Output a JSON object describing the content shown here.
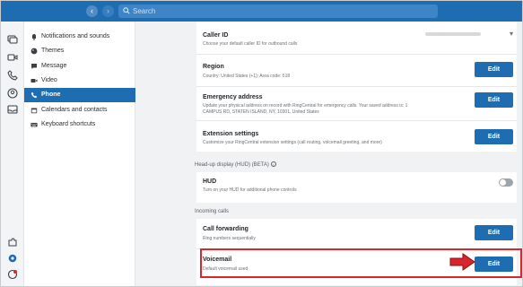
{
  "topbar": {
    "search_placeholder": "Search",
    "back_icon": "chevron-left-icon",
    "forward_icon": "chevron-right-icon",
    "color": "#1e6db3"
  },
  "settings_nav": {
    "items": [
      {
        "label": "Notifications and sounds",
        "icon": "bell-icon"
      },
      {
        "label": "Themes",
        "icon": "palette-icon"
      },
      {
        "label": "Message",
        "icon": "message-icon"
      },
      {
        "label": "Video",
        "icon": "video-icon"
      },
      {
        "label": "Phone",
        "icon": "phone-icon",
        "active": true
      },
      {
        "label": "Calendars and contacts",
        "icon": "calendar-icon"
      },
      {
        "label": "Keyboard shortcuts",
        "icon": "keyboard-icon"
      }
    ]
  },
  "phone_settings": {
    "caller_id": {
      "title": "Caller ID",
      "desc": "Choose your default caller ID for outbound calls"
    },
    "region": {
      "title": "Region",
      "desc": "Country: United States (+1); Area code: 518",
      "button": "Edit"
    },
    "emergency": {
      "title": "Emergency address",
      "desc": "Update your physical address on record with RingCentral for emergency calls. Your saved address is: 1 CAMPUS RD, STATEN ISLAND, NY, 10301, United States",
      "button": "Edit"
    },
    "extension": {
      "title": "Extension settings",
      "desc": "Customize your RingCentral extension settings (call routing, voicemail greeting, and more)",
      "button": "Edit"
    },
    "hud_section": "Head-up display (HUD) (BETA)",
    "hud": {
      "title": "HUD",
      "desc": "Turn on your HUD for additional phone controls",
      "enabled": false
    },
    "incoming_section": "Incoming calls",
    "call_forwarding": {
      "title": "Call forwarding",
      "desc": "Ring numbers sequentially",
      "button": "Edit"
    },
    "voicemail": {
      "title": "Voicemail",
      "desc": "Default voicemail used",
      "button": "Edit"
    }
  },
  "colors": {
    "accent": "#1e6db3",
    "highlight": "#d7262c"
  }
}
